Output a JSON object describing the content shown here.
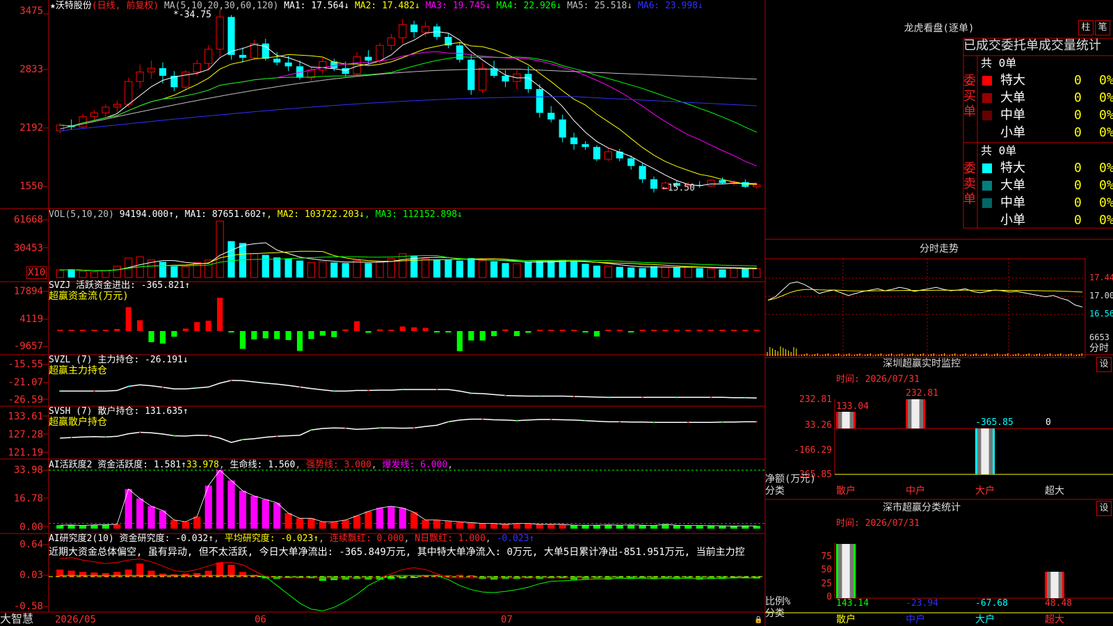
{
  "stock": {
    "star": "★",
    "name": "沃特股份",
    "period_label": "(日线, 前复权)",
    "ma_params": "MA(5,10,20,30,60,120)",
    "ma_values": [
      {
        "label": "MA1: 17.564↓",
        "color": "#ffffff"
      },
      {
        "label": "MA2: 17.482↓",
        "color": "#ffff00"
      },
      {
        "label": "MA3: 19.745↓",
        "color": "#ff00ff"
      },
      {
        "label": "MA4: 22.926↓",
        "color": "#00ff00"
      },
      {
        "label": "MA5: 25.518↓",
        "color": "#c0c0c0"
      },
      {
        "label": "MA6: 23.998↓",
        "color": "#3030ff"
      }
    ],
    "y_ticks": [
      "3475",
      "2833",
      "2192",
      "1550"
    ],
    "high_label": "34.75",
    "low_label": "←15.50"
  },
  "volume": {
    "title": "VOL(5,10,20)",
    "value": "94194.000↑",
    "ma_labels": [
      {
        "label": "MA1: 87651.602↑",
        "color": "#ffffff"
      },
      {
        "label": "MA2: 103722.203↓",
        "color": "#ffff00"
      },
      {
        "label": "MA3: 112152.898↓",
        "color": "#00ff00"
      }
    ],
    "y_ticks": [
      "61668",
      "30453"
    ],
    "unit": "X10"
  },
  "svzj": {
    "title": "SVZJ  活跃资金进出: -365.821↑",
    "subtitle": "超赢资金流(万元)",
    "y_ticks": [
      "17894",
      "4119",
      "-9657"
    ]
  },
  "svzl": {
    "title": "SVZL (7) 主力持仓: -26.191↓",
    "subtitle": "超赢主力持仓",
    "y_ticks": [
      "-15.55",
      "-21.07",
      "-26.59"
    ]
  },
  "svsh": {
    "title": "SVSH (7) 散户持仓: 131.635↑",
    "subtitle": "超赢散户持仓",
    "y_ticks": [
      "133.61",
      "127.28",
      "121.19"
    ]
  },
  "ai_active": {
    "title": "AI活跃度2 资金活跃度: 1.581↑",
    "value2": "33.978",
    "life_line": "生命线: 1.560",
    "strong_line": "强势线: 3.000",
    "burst_line": "爆发线: 6.000",
    "y_ticks": [
      "33.98",
      "16.78",
      "0.00"
    ]
  },
  "ai_research": {
    "title": "AI研究度2(10) 资金研究度: -0.032↑",
    "avg": "平均研究度: -0.023↑",
    "cont_red": "连续飘红: 0.000",
    "n_red": "N日飘红: 1.000",
    "last": "-0.023↑",
    "comment": "近期大资金总体偏空, 虽有异动, 但不太活跃, 今日大单净流出: -365.849万元, 其中特大单净流入: 0万元, 大单5日累计净出-851.951万元, 当前主力控",
    "y_ticks": [
      "0.64",
      "0.03",
      "-0.58"
    ]
  },
  "x_axis": {
    "labels": [
      "2026/05",
      "06",
      "07"
    ],
    "brand": "大智慧"
  },
  "lhb": {
    "title": "龙虎看盘(逐单)",
    "btn_bar": "柱",
    "btn_stroke": "笔",
    "subtitle": "已成交委托单成交量统计",
    "buy_label": "委买单",
    "sell_label": "委卖单",
    "buy_total": "共 0单",
    "sell_total": "共 0单",
    "buy_rows": [
      {
        "label": "特大",
        "count": "0",
        "pct": "0%",
        "color": "#ff0000"
      },
      {
        "label": "大单",
        "count": "0",
        "pct": "0%",
        "color": "#990000"
      },
      {
        "label": "中单",
        "count": "0",
        "pct": "0%",
        "color": "#660000"
      },
      {
        "label": "小单",
        "count": "0",
        "pct": "0%",
        "color": ""
      }
    ],
    "sell_rows": [
      {
        "label": "特大",
        "count": "0",
        "pct": "0%",
        "color": "#00ffff"
      },
      {
        "label": "大单",
        "count": "0",
        "pct": "0%",
        "color": "#008080"
      },
      {
        "label": "中单",
        "count": "0",
        "pct": "0%",
        "color": "#006666"
      },
      {
        "label": "小单",
        "count": "0",
        "pct": "0%",
        "color": ""
      }
    ]
  },
  "intraday": {
    "title": "分时走势",
    "prices": [
      "17.44",
      "17.00",
      "16.56"
    ],
    "vol_label": "6653",
    "unit": "分时"
  },
  "sz_monitor": {
    "title": "深圳超赢实时监控",
    "btn_settings": "设",
    "time": "时间: 2026/07/31",
    "y_ticks": [
      "232.81",
      "33.26",
      "-166.29",
      "-365.85"
    ],
    "bar_labels": [
      "133.04",
      "232.81",
      "-365.85",
      "0"
    ],
    "y_unit": "净额(万元)",
    "x_unit": "分类",
    "categories": [
      "散户",
      "中户",
      "大户",
      "超大"
    ]
  },
  "sz_class": {
    "title": "深市超赢分类统计",
    "btn_settings": "设",
    "time": "时间: 2026/07/31",
    "y_ticks": [
      "75",
      "50",
      "25",
      "0"
    ],
    "values": [
      "143.14",
      "-23.94",
      "-67.68",
      "48.48"
    ],
    "y_unit": "比例%",
    "x_unit": "分类",
    "categories": [
      "散户",
      "中户",
      "大户",
      "超大"
    ]
  },
  "colors": {
    "up": "#ff0000",
    "down": "#00ffff",
    "border": "#c00000",
    "ma1": "#ffffff",
    "ma2": "#ffff00",
    "ma3": "#ff00ff",
    "ma4": "#00ff00",
    "ma5": "#c0c0c0",
    "ma6": "#3030ff"
  },
  "candles": [
    [
      22.0,
      22.8,
      21.7,
      22.6
    ],
    [
      22.6,
      23.2,
      22.1,
      22.4
    ],
    [
      22.4,
      23.8,
      22.2,
      23.5
    ],
    [
      23.5,
      24.2,
      23.0,
      23.9
    ],
    [
      23.9,
      24.8,
      23.5,
      24.5
    ],
    [
      24.5,
      25.2,
      24.0,
      24.8
    ],
    [
      24.8,
      27.6,
      24.5,
      27.2
    ],
    [
      27.2,
      29.0,
      26.5,
      28.2
    ],
    [
      28.2,
      29.4,
      27.5,
      28.6
    ],
    [
      28.6,
      29.2,
      27.0,
      27.8
    ],
    [
      27.8,
      28.3,
      26.2,
      26.6
    ],
    [
      26.6,
      28.4,
      26.3,
      28.2
    ],
    [
      28.2,
      29.5,
      27.8,
      29.1
    ],
    [
      29.1,
      31.0,
      28.5,
      30.6
    ],
    [
      30.6,
      34.75,
      29.8,
      34.0
    ],
    [
      34.0,
      34.2,
      29.5,
      30.0
    ],
    [
      30.0,
      30.8,
      29.2,
      29.7
    ],
    [
      29.7,
      31.6,
      29.5,
      31.2
    ],
    [
      31.2,
      31.7,
      29.4,
      29.6
    ],
    [
      29.6,
      30.3,
      28.9,
      29.2
    ],
    [
      29.2,
      29.9,
      28.3,
      28.8
    ],
    [
      28.8,
      29.4,
      27.4,
      27.6
    ],
    [
      27.6,
      28.7,
      27.3,
      28.4
    ],
    [
      28.4,
      29.7,
      28.0,
      29.3
    ],
    [
      29.3,
      29.6,
      28.3,
      28.6
    ],
    [
      28.6,
      29.3,
      27.7,
      28.0
    ],
    [
      28.0,
      30.3,
      27.8,
      29.8
    ],
    [
      29.8,
      30.5,
      29.0,
      29.4
    ],
    [
      29.4,
      31.3,
      29.1,
      31.0
    ],
    [
      31.0,
      32.2,
      30.5,
      31.8
    ],
    [
      31.8,
      33.8,
      31.2,
      33.2
    ],
    [
      33.2,
      33.6,
      31.8,
      32.4
    ],
    [
      32.4,
      33.5,
      31.9,
      33.0
    ],
    [
      33.0,
      33.3,
      31.6,
      31.9
    ],
    [
      31.9,
      32.3,
      30.7,
      31.0
    ],
    [
      31.0,
      31.4,
      29.2,
      29.5
    ],
    [
      29.5,
      30.1,
      25.8,
      26.3
    ],
    [
      26.3,
      29.2,
      26.0,
      28.6
    ],
    [
      28.6,
      29.4,
      27.6,
      27.8
    ],
    [
      27.8,
      28.4,
      26.6,
      27.2
    ],
    [
      27.2,
      28.4,
      26.4,
      28.0
    ],
    [
      28.0,
      28.8,
      26.0,
      26.4
    ],
    [
      26.4,
      26.9,
      23.4,
      23.9
    ],
    [
      23.9,
      24.6,
      22.9,
      23.2
    ],
    [
      23.2,
      23.7,
      20.8,
      21.3
    ],
    [
      21.3,
      21.8,
      20.0,
      20.6
    ],
    [
      20.6,
      20.9,
      20.0,
      20.3
    ],
    [
      20.3,
      20.5,
      18.8,
      19.0
    ],
    [
      19.0,
      20.2,
      18.8,
      19.8
    ],
    [
      19.8,
      20.1,
      18.8,
      19.1
    ],
    [
      19.1,
      19.4,
      17.9,
      18.3
    ],
    [
      18.3,
      18.6,
      16.5,
      16.9
    ],
    [
      16.9,
      17.2,
      15.5,
      15.9
    ],
    [
      15.9,
      16.7,
      15.8,
      16.5
    ],
    [
      16.5,
      16.8,
      16.0,
      16.2
    ],
    [
      16.2,
      16.6,
      16.1,
      16.3
    ],
    [
      16.3,
      16.7,
      16.0,
      16.2
    ],
    [
      16.2,
      16.9,
      16.1,
      16.8
    ],
    [
      16.8,
      17.1,
      16.4,
      16.5
    ],
    [
      16.5,
      16.8,
      16.2,
      16.6
    ],
    [
      16.6,
      16.9,
      16.0,
      16.1
    ],
    [
      16.1,
      16.5,
      15.9,
      16.3
    ]
  ],
  "volumes": [
    12,
    13,
    10,
    9,
    11,
    18,
    31,
    33,
    28,
    25,
    18,
    17,
    24,
    28,
    90,
    58,
    55,
    38,
    36,
    32,
    30,
    27,
    24,
    25,
    24,
    23,
    27,
    23,
    25,
    30,
    38,
    35,
    30,
    28,
    28,
    27,
    31,
    27,
    26,
    23,
    22,
    25,
    26,
    27,
    28,
    26,
    22,
    19,
    18,
    17,
    16,
    15,
    18,
    17,
    16,
    17,
    15,
    14,
    13,
    15,
    14,
    14
  ],
  "flows": [
    0.5,
    0.4,
    0.3,
    0.4,
    0.3,
    1.0,
    11.5,
    5.2,
    -5.3,
    -6.0,
    -2.7,
    1.2,
    4.3,
    5.0,
    16.0,
    -0.6,
    -8.5,
    -4.0,
    -3.5,
    -3.8,
    -4.3,
    -9.5,
    -3.8,
    -2.2,
    -2.9,
    0.8,
    4.7,
    -0.8,
    0.8,
    0.7,
    2.2,
    1.8,
    1.5,
    -0.5,
    -0.2,
    -9.6,
    -4.5,
    -4.5,
    -2.4,
    0.8,
    -2.4,
    -0.8,
    0.3,
    0.2,
    0.2,
    0.4,
    -0.3,
    -2.6,
    0.4,
    0.3,
    -0.4,
    0.3,
    0.4,
    0.2,
    0.3,
    0.4,
    0.2,
    0.3,
    0.3,
    0.2,
    0.3,
    0.3
  ],
  "svzl_series": [
    -24.0,
    -24.0,
    -24.0,
    -24.0,
    -24.0,
    -23.8,
    -22.5,
    -22.0,
    -22.3,
    -22.8,
    -23.3,
    -23.3,
    -23.0,
    -22.7,
    -21.5,
    -20.6,
    -20.7,
    -21.1,
    -21.5,
    -21.8,
    -22.2,
    -22.7,
    -23.2,
    -23.6,
    -24.0,
    -24.0,
    -23.8,
    -23.8,
    -23.7,
    -23.7,
    -23.5,
    -23.5,
    -23.5,
    -23.5,
    -23.5,
    -24.0,
    -24.7,
    -24.8,
    -25.1,
    -25.4,
    -25.5,
    -25.6,
    -25.6,
    -25.6,
    -25.6,
    -25.7,
    -25.8,
    -25.9,
    -26.0,
    -26.0,
    -26.0,
    -26.0,
    -26.0,
    -26.0,
    -26.0,
    -26.0,
    -26.0,
    -26.0,
    -26.0,
    -26.1,
    -26.1,
    -26.2
  ],
  "svsh_series": [
    126.0,
    126.2,
    126.4,
    126.5,
    126.4,
    126.6,
    127.5,
    128.0,
    127.8,
    127.4,
    126.8,
    126.7,
    127.0,
    126.9,
    126.0,
    124.5,
    125.5,
    125.8,
    126.3,
    126.6,
    126.8,
    127.0,
    128.8,
    129.3,
    129.5,
    129.4,
    129.0,
    129.2,
    129.5,
    129.5,
    129.4,
    129.5,
    130.0,
    130.4,
    131.6,
    132.2,
    132.5,
    132.5,
    132.3,
    132.2,
    132.0,
    132.2,
    132.4,
    132.4,
    132.3,
    132.2,
    132.0,
    131.8,
    131.6,
    131.6,
    131.5,
    131.5,
    131.4,
    131.4,
    131.4,
    131.4,
    131.4,
    131.4,
    131.5,
    131.5,
    131.6,
    131.6
  ],
  "active_series": [
    2.0,
    2.1,
    1.8,
    2.2,
    2.3,
    2.5,
    23.0,
    17.5,
    13.0,
    10.5,
    5.0,
    4.0,
    7.0,
    25.0,
    33.978,
    28.0,
    22.0,
    19.0,
    17.0,
    15.0,
    9.0,
    6.0,
    6.0,
    4.0,
    4.0,
    5.0,
    7.5,
    10.0,
    12.0,
    13.0,
    12.0,
    9.5,
    5.0,
    5.0,
    4.5,
    4.0,
    3.5,
    3.0,
    3.0,
    2.5,
    3.0,
    3.0,
    2.5,
    2.5,
    2.5,
    2.0,
    2.0,
    2.0,
    2.2,
    2.0,
    2.2,
    2.0,
    1.8,
    2.5,
    2.0,
    1.8,
    1.8,
    1.7,
    1.6,
    1.5,
    1.6,
    1.581
  ],
  "research_bars": [
    0.12,
    0.1,
    0.08,
    0.07,
    0.06,
    0.08,
    0.12,
    0.22,
    0.1,
    0.05,
    0.04,
    0.05,
    0.06,
    0.1,
    0.24,
    0.2,
    0.08,
    0.03,
    -0.03,
    -0.04,
    -0.02,
    -0.01,
    -0.03,
    -0.07,
    -0.06,
    -0.05,
    -0.04,
    -0.05,
    -0.05,
    -0.04,
    -0.03,
    -0.02,
    0.02,
    0.03,
    0.02,
    0.03,
    0.02,
    -0.04,
    -0.05,
    -0.04,
    -0.04,
    -0.03,
    -0.04,
    -0.03,
    -0.03,
    -0.05,
    -0.04,
    -0.03,
    -0.05,
    -0.03,
    -0.04,
    -0.03,
    -0.04,
    -0.03,
    -0.04,
    -0.03,
    -0.05,
    -0.04,
    -0.04,
    -0.03,
    -0.03,
    -0.032
  ],
  "research_line": [
    0.3,
    0.32,
    0.28,
    0.25,
    0.22,
    0.24,
    0.28,
    0.3,
    0.25,
    0.18,
    0.1,
    0.08,
    0.12,
    0.18,
    0.24,
    0.24,
    0.2,
    0.1,
    0.0,
    -0.15,
    -0.3,
    -0.45,
    -0.55,
    -0.58,
    -0.52,
    -0.42,
    -0.3,
    -0.15,
    -0.05,
    0.05,
    0.12,
    0.15,
    0.12,
    0.05,
    -0.05,
    -0.15,
    -0.22,
    -0.26,
    -0.27,
    -0.25,
    -0.22,
    -0.18,
    -0.12,
    -0.08,
    -0.07,
    -0.06,
    -0.05,
    -0.04,
    -0.04,
    -0.03,
    -0.03,
    -0.03,
    -0.04,
    -0.03,
    -0.03,
    -0.03,
    -0.04,
    -0.03,
    -0.03,
    -0.02,
    -0.02,
    -0.023
  ],
  "intraday_price": [
    17.05,
    17.1,
    17.2,
    17.3,
    17.32,
    17.28,
    17.22,
    17.15,
    17.18,
    17.2,
    17.16,
    17.12,
    17.15,
    17.18,
    17.2,
    17.22,
    17.19,
    17.21,
    17.24,
    17.22,
    17.18,
    17.2,
    17.22,
    17.24,
    17.21,
    17.19,
    17.2,
    17.22,
    17.18,
    17.16,
    17.18,
    17.2,
    17.19,
    17.17,
    17.18,
    17.16,
    17.14,
    17.12,
    17.1,
    17.12,
    17.08,
    17.05,
    16.98,
    16.95
  ]
}
